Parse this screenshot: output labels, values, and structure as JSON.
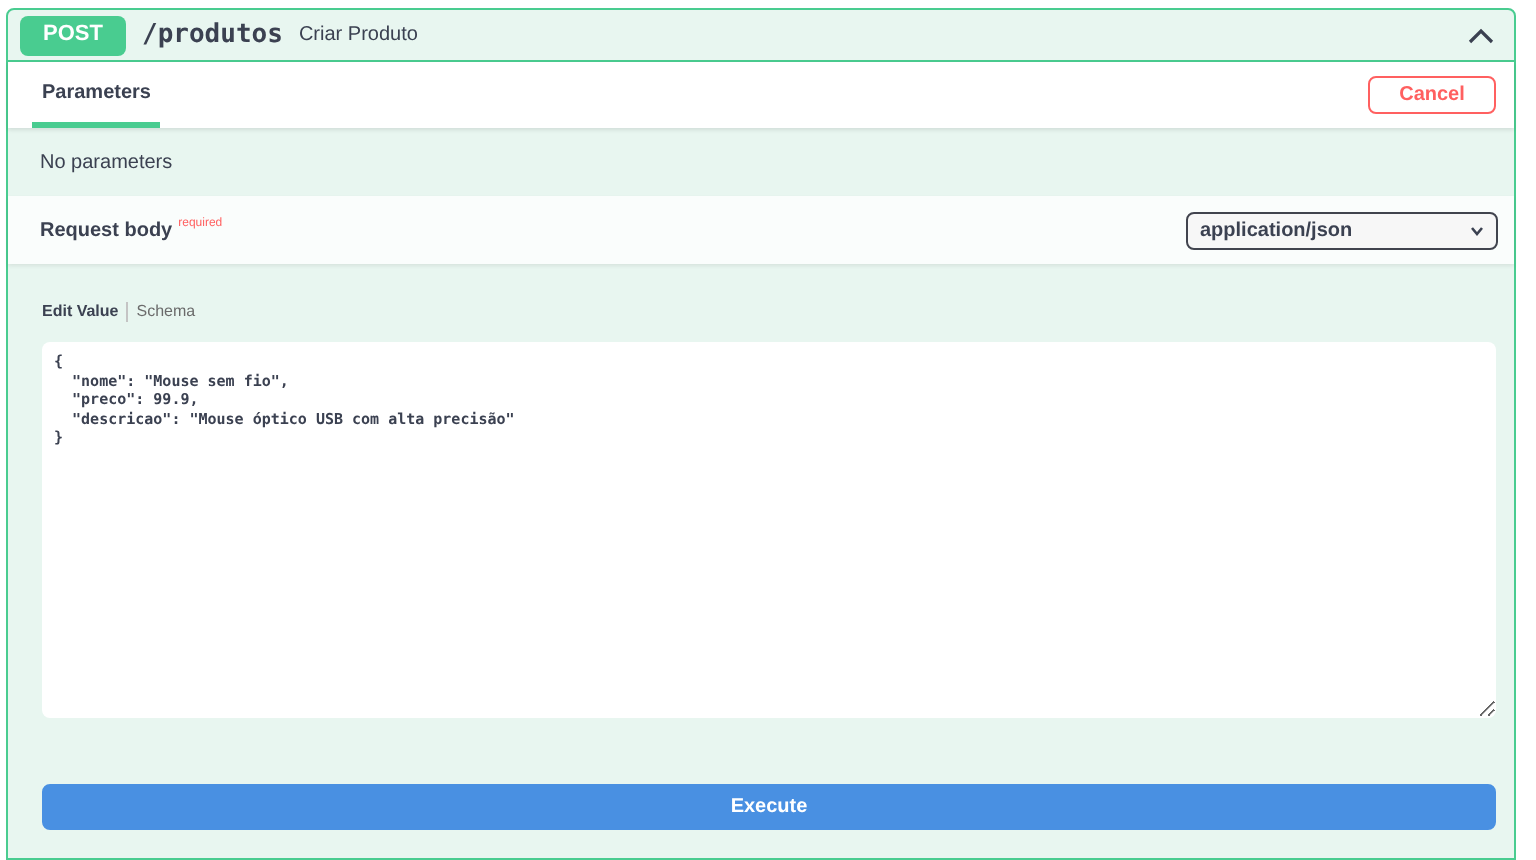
{
  "operation": {
    "method": "POST",
    "path": "/produtos",
    "summary": "Criar Produto",
    "expanded": true
  },
  "tabs": [
    {
      "label": "Parameters",
      "selected": true
    }
  ],
  "cancel_button": "Cancel",
  "parameters_message": "No parameters",
  "request_body": {
    "label": "Request body",
    "required_mark": "required",
    "content_type": "application/json"
  },
  "editor_tabs": [
    {
      "label": "Edit Value",
      "selected": true
    },
    {
      "label": "Schema",
      "selected": false
    }
  ],
  "body_value": "{\n  \"nome\": \"Mouse sem fio\",\n  \"preco\": 99.9,\n  \"descricao\": \"Mouse óptico USB com alta precisão\"\n}",
  "execute_button": "Execute"
}
